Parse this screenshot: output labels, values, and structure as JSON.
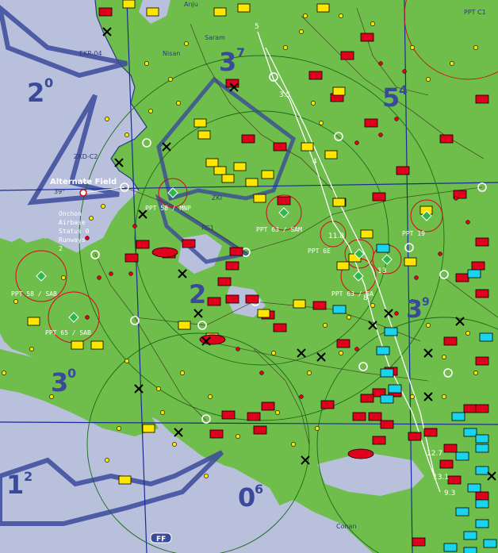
{
  "sector_labels": [
    {
      "main": "2",
      "sup": "0"
    },
    {
      "main": "3",
      "sup": "7"
    },
    {
      "main": "5",
      "sup": "4"
    },
    {
      "main": "2",
      "sup": ""
    },
    {
      "main": "3",
      "sup": "9"
    },
    {
      "main": "3",
      "sup": "0"
    },
    {
      "main": "1",
      "sup": "2"
    },
    {
      "main": "0",
      "sup": "6"
    }
  ],
  "route_labels": [
    "EKR-04",
    "ZKD-C2",
    "ZKI",
    "RC1",
    "PPT C1"
  ],
  "place_labels": [
    "Anju",
    "Saram",
    "Nisan",
    "Conan"
  ],
  "waypoint_numbers": [
    "5",
    "3.5",
    "4",
    "11.8",
    "13",
    "8",
    "12.7",
    "13.1",
    "9.3"
  ],
  "grid_label": "39°",
  "alternate_field": {
    "title": "Alternate Field",
    "info": [
      "Onchon",
      "Airbase",
      "Status 0",
      "Runways",
      "2"
    ]
  },
  "sam_labels": [
    "PPT 58 / MNP",
    "PPT 63 / SAM",
    "PPT 58 / SAB",
    "PPT 65 / SAB",
    "PPT 6E",
    "PPT 63 / SA",
    "PPT 19"
  ],
  "bottom_marker": "FF",
  "colors": {
    "sea": "#b8c0dc",
    "land": "#6fbe4c",
    "threat": "#e0001c",
    "friendly": "#ffe600",
    "cyan_units": "#19d4ec",
    "route": "#ffffff",
    "grid_lines": "#1a2a9a"
  }
}
